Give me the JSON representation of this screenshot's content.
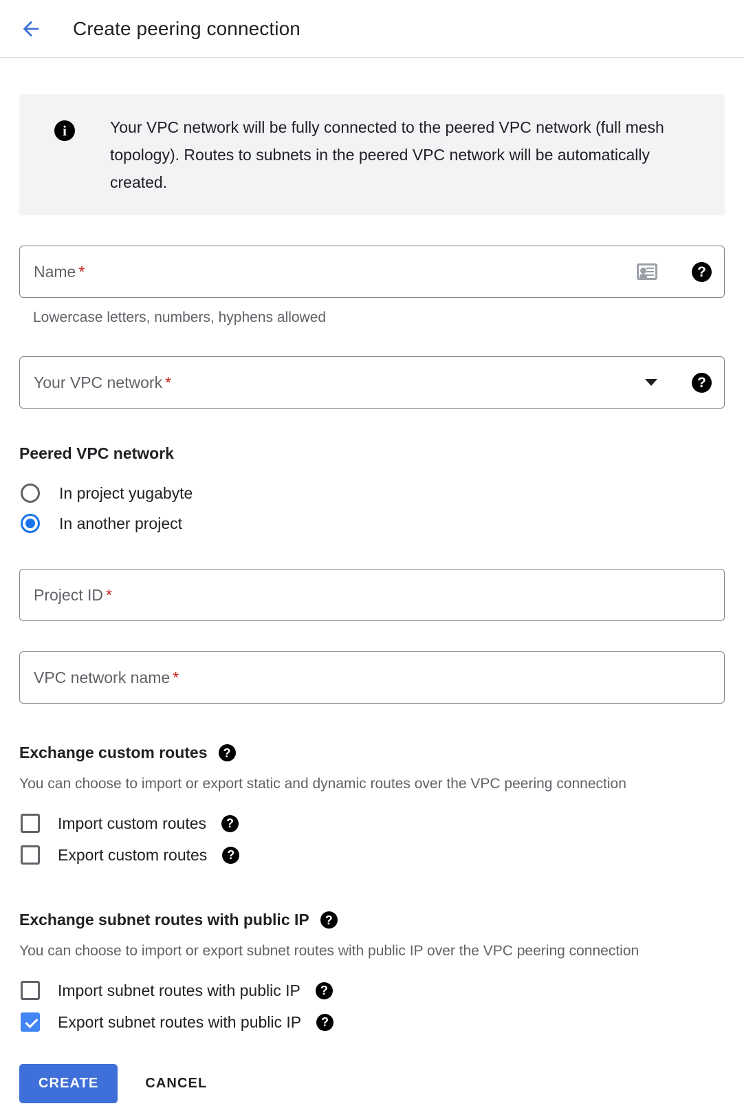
{
  "header": {
    "back_icon": "back-arrow-icon",
    "title": "Create peering connection",
    "accent_color": "#3f6fd8"
  },
  "info_banner": {
    "icon": "info-icon",
    "text": "Your VPC network will be fully connected to the peered VPC network (full mesh topology). Routes to subnets in the peered VPC network will be automatically created.",
    "background_color": "#f1f3f4"
  },
  "form": {
    "name_field": {
      "label": "Name",
      "required_marker": "*",
      "value": "",
      "placeholder": "Name",
      "contact_icon": "contact-card-icon",
      "help_icon": "help-icon",
      "helper_text": "Lowercase letters, numbers, hyphens allowed"
    },
    "your_vpc_network": {
      "label": "Your VPC network",
      "required_marker": "*",
      "value": "",
      "dropdown_icon": "chevron-down-icon",
      "help_icon": "help-icon"
    },
    "peered_vpc_network": {
      "title": "Peered VPC network",
      "options": [
        {
          "label": "In project yugabyte",
          "selected": false
        },
        {
          "label": "In another project",
          "selected": true
        }
      ]
    },
    "project_id_field": {
      "label": "Project ID",
      "required_marker": "*",
      "value": "",
      "placeholder": "Project ID"
    },
    "vpc_network_name_field": {
      "label": "VPC network name",
      "required_marker": "*",
      "value": "",
      "placeholder": "VPC network name"
    },
    "exchange_custom_routes": {
      "title": "Exchange custom routes",
      "help_icon": "help-icon",
      "description": "You can choose to import or export static and dynamic routes over the VPC peering connection",
      "checkboxes": [
        {
          "label": "Import custom routes",
          "checked": false,
          "help_icon": "help-icon"
        },
        {
          "label": "Export custom routes",
          "checked": false,
          "help_icon": "help-icon"
        }
      ]
    },
    "exchange_subnet_routes_public_ip": {
      "title": "Exchange subnet routes with public IP",
      "help_icon": "help-icon",
      "description": "You can choose to import or export subnet routes with public IP over the VPC peering connection",
      "checkboxes": [
        {
          "label": "Import subnet routes with public IP",
          "checked": false,
          "help_icon": "help-icon"
        },
        {
          "label": "Export subnet routes with public IP",
          "checked": true,
          "help_icon": "help-icon"
        }
      ]
    }
  },
  "actions": {
    "create_label": "CREATE",
    "cancel_label": "CANCEL",
    "create_color": "#3f6fd8"
  },
  "glyphs": {
    "help": "?",
    "info": "i"
  }
}
